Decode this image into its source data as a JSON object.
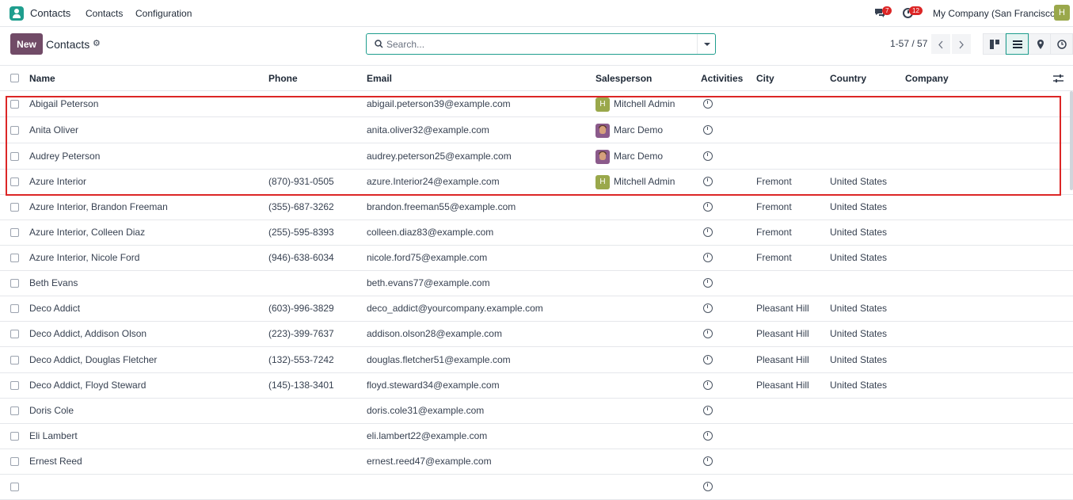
{
  "navbar": {
    "app_name": "Contacts",
    "menu": [
      "Contacts",
      "Configuration"
    ],
    "messages_count": "7",
    "activities_count": "12",
    "company": "My Company (San Francisco)",
    "user_initial": "H"
  },
  "control_panel": {
    "new_label": "New",
    "breadcrumb": "Contacts",
    "search_placeholder": "Search...",
    "pager": "1-57 / 57"
  },
  "table": {
    "columns": [
      "Name",
      "Phone",
      "Email",
      "Salesperson",
      "Activities",
      "City",
      "Country",
      "Company"
    ],
    "rows": [
      {
        "name": "Abigail Peterson",
        "phone": "",
        "email": "abigail.peterson39@example.com",
        "salesperson": "Mitchell Admin",
        "avatar": "H",
        "city": "",
        "country": "",
        "company": ""
      },
      {
        "name": "Anita Oliver",
        "phone": "",
        "email": "anita.oliver32@example.com",
        "salesperson": "Marc Demo",
        "avatar": "photo",
        "city": "",
        "country": "",
        "company": ""
      },
      {
        "name": "Audrey Peterson",
        "phone": "",
        "email": "audrey.peterson25@example.com",
        "salesperson": "Marc Demo",
        "avatar": "photo",
        "city": "",
        "country": "",
        "company": ""
      },
      {
        "name": "Azure Interior",
        "phone": "(870)-931-0505",
        "email": "azure.Interior24@example.com",
        "salesperson": "Mitchell Admin",
        "avatar": "H",
        "city": "Fremont",
        "country": "United States",
        "company": ""
      },
      {
        "name": "Azure Interior, Brandon Freeman",
        "phone": "(355)-687-3262",
        "email": "brandon.freeman55@example.com",
        "salesperson": "",
        "avatar": "",
        "city": "Fremont",
        "country": "United States",
        "company": ""
      },
      {
        "name": "Azure Interior, Colleen Diaz",
        "phone": "(255)-595-8393",
        "email": "colleen.diaz83@example.com",
        "salesperson": "",
        "avatar": "",
        "city": "Fremont",
        "country": "United States",
        "company": ""
      },
      {
        "name": "Azure Interior, Nicole Ford",
        "phone": "(946)-638-6034",
        "email": "nicole.ford75@example.com",
        "salesperson": "",
        "avatar": "",
        "city": "Fremont",
        "country": "United States",
        "company": ""
      },
      {
        "name": "Beth Evans",
        "phone": "",
        "email": "beth.evans77@example.com",
        "salesperson": "",
        "avatar": "",
        "city": "",
        "country": "",
        "company": ""
      },
      {
        "name": "Deco Addict",
        "phone": "(603)-996-3829",
        "email": "deco_addict@yourcompany.example.com",
        "salesperson": "",
        "avatar": "",
        "city": "Pleasant Hill",
        "country": "United States",
        "company": ""
      },
      {
        "name": "Deco Addict, Addison Olson",
        "phone": "(223)-399-7637",
        "email": "addison.olson28@example.com",
        "salesperson": "",
        "avatar": "",
        "city": "Pleasant Hill",
        "country": "United States",
        "company": ""
      },
      {
        "name": "Deco Addict, Douglas Fletcher",
        "phone": "(132)-553-7242",
        "email": "douglas.fletcher51@example.com",
        "salesperson": "",
        "avatar": "",
        "city": "Pleasant Hill",
        "country": "United States",
        "company": ""
      },
      {
        "name": "Deco Addict, Floyd Steward",
        "phone": "(145)-138-3401",
        "email": "floyd.steward34@example.com",
        "salesperson": "",
        "avatar": "",
        "city": "Pleasant Hill",
        "country": "United States",
        "company": ""
      },
      {
        "name": "Doris Cole",
        "phone": "",
        "email": "doris.cole31@example.com",
        "salesperson": "",
        "avatar": "",
        "city": "",
        "country": "",
        "company": ""
      },
      {
        "name": "Eli Lambert",
        "phone": "",
        "email": "eli.lambert22@example.com",
        "salesperson": "",
        "avatar": "",
        "city": "",
        "country": "",
        "company": ""
      },
      {
        "name": "Ernest Reed",
        "phone": "",
        "email": "ernest.reed47@example.com",
        "salesperson": "",
        "avatar": "",
        "city": "",
        "country": "",
        "company": ""
      },
      {
        "name": "",
        "phone": "",
        "email": "",
        "salesperson": "",
        "avatar": "",
        "city": "",
        "country": "",
        "company": ""
      }
    ]
  },
  "colors": {
    "brand": "#714b67",
    "accent": "#1f9e8e",
    "highlight": "#dc2626",
    "badge": "#dc2626"
  }
}
